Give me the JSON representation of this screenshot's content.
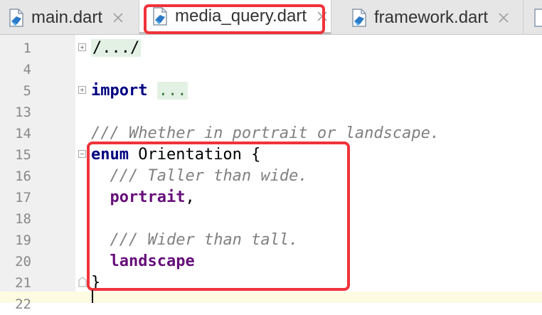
{
  "tabs": [
    {
      "label": "main.dart",
      "active": false
    },
    {
      "label": "media_query.dart",
      "active": true
    },
    {
      "label": "framework.dart",
      "active": false
    }
  ],
  "editor": {
    "lines": [
      {
        "number": "1",
        "fold": "plus",
        "parts": [
          {
            "text": "/.../",
            "style": "folded"
          }
        ]
      },
      {
        "number": "4",
        "fold": "",
        "parts": []
      },
      {
        "number": "5",
        "fold": "plus",
        "parts": [
          {
            "text": "import",
            "style": "kw"
          },
          {
            "text": " ",
            "style": ""
          },
          {
            "text": "...",
            "style": "folded muted"
          }
        ]
      },
      {
        "number": "13",
        "fold": "",
        "parts": []
      },
      {
        "number": "14",
        "fold": "",
        "parts": [
          {
            "text": "/// Whether in portrait or landscape.",
            "style": "doc"
          }
        ]
      },
      {
        "number": "15",
        "fold": "minus",
        "parts": [
          {
            "text": "enum",
            "style": "kw"
          },
          {
            "text": " Orientation {",
            "style": ""
          }
        ]
      },
      {
        "number": "16",
        "fold": "",
        "parts": [
          {
            "text": "  ",
            "style": ""
          },
          {
            "text": "/// Taller than wide.",
            "style": "doc"
          }
        ]
      },
      {
        "number": "17",
        "fold": "",
        "parts": [
          {
            "text": "  ",
            "style": ""
          },
          {
            "text": "portrait",
            "style": "ident"
          },
          {
            "text": ",",
            "style": ""
          }
        ]
      },
      {
        "number": "18",
        "fold": "",
        "parts": []
      },
      {
        "number": "19",
        "fold": "",
        "parts": [
          {
            "text": "  ",
            "style": ""
          },
          {
            "text": "/// Wider than tall.",
            "style": "doc"
          }
        ]
      },
      {
        "number": "20",
        "fold": "",
        "parts": [
          {
            "text": "  ",
            "style": ""
          },
          {
            "text": "landscape",
            "style": "ident"
          }
        ]
      },
      {
        "number": "21",
        "fold": "end",
        "parts": [
          {
            "text": "}",
            "style": ""
          }
        ]
      },
      {
        "number": "22",
        "fold": "",
        "parts": []
      }
    ]
  },
  "colors": {
    "highlight_border": "#f0323a",
    "keyword": "#000080",
    "doc_comment": "#808080",
    "enum_constant": "#660e7a",
    "folded_background": "#e3f1e4"
  }
}
